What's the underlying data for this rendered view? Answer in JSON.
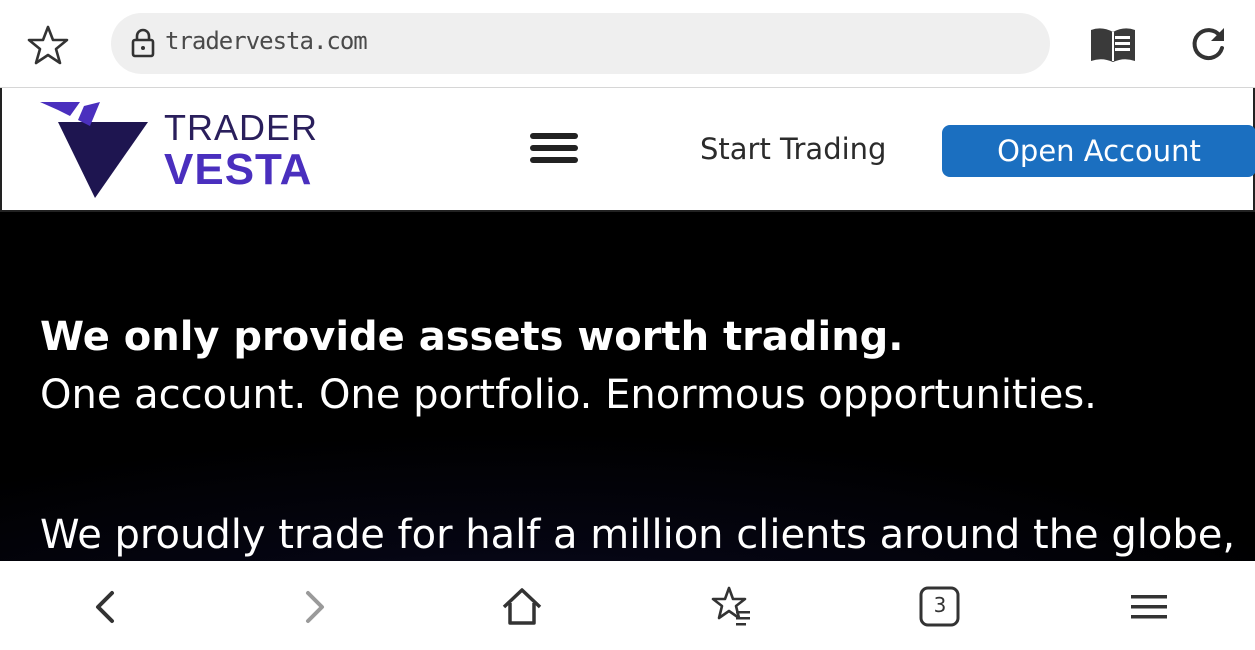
{
  "browser": {
    "url": "tradervesta.com",
    "tabs_count": "3",
    "icons": {
      "bookmark": "star-outline-icon",
      "lock": "lock-icon",
      "reader": "reader-mode-icon",
      "reload": "reload-icon",
      "back": "chevron-left-icon",
      "forward": "chevron-right-icon",
      "home": "home-icon",
      "bookmarks": "bookmarks-list-icon",
      "tabs": "tabs-icon",
      "menu": "hamburger-menu-icon"
    }
  },
  "site": {
    "logo_line1": "TRADER",
    "logo_line2": "VESTA",
    "nav_start_trading": "Start Trading",
    "open_account": "Open Account",
    "colors": {
      "brand_dark": "#2a1f5c",
      "brand_purple": "#4a2fbe",
      "cta_blue": "#1b6fc0"
    }
  },
  "hero": {
    "headline": "We only provide assets worth trading.",
    "subline": "One account. One portfolio. Enormous opportunities.",
    "body": "We proudly trade for half a million clients around the globe,"
  }
}
